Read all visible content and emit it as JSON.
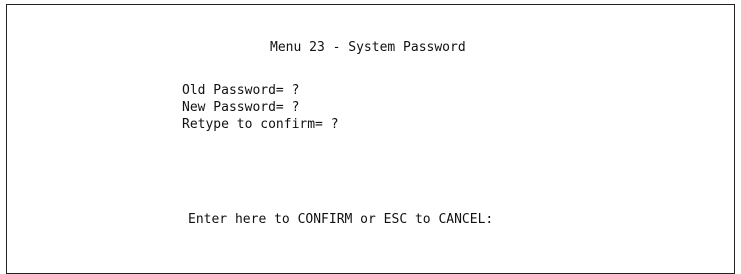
{
  "menu": {
    "title": "Menu 23 - System Password"
  },
  "fields": [
    {
      "label": "Old Password= ",
      "value": "?"
    },
    {
      "label": "New Password= ",
      "value": "?"
    },
    {
      "label": "Retype to confirm= ",
      "value": "?"
    }
  ],
  "prompt": {
    "text": "Enter here to CONFIRM or ESC to CANCEL:"
  }
}
